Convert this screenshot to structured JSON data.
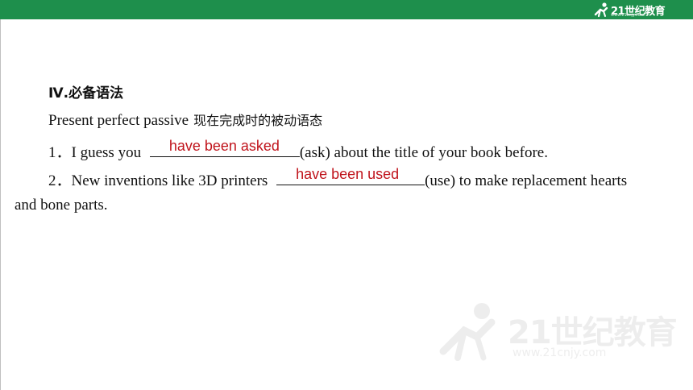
{
  "header": {
    "logo_text": "21世纪教育",
    "logo_url": "www.21cnjy.com",
    "bar_color": "#1e8f4c"
  },
  "content": {
    "heading": "Ⅳ.必备语法",
    "subheading_en": "Present perfect passive",
    "subheading_cn": "现在完成时的被动语态",
    "q1": {
      "number": "1．",
      "before": "I guess you",
      "answer": "have been asked",
      "after": "(ask) about the title of your book before."
    },
    "q2": {
      "number": "2．",
      "before": "New inventions like 3D printers",
      "answer": "have been used",
      "after": "(use) to make replacement hearts",
      "continuation": "and bone parts."
    },
    "answer_color": "#c0141c"
  },
  "watermark": {
    "text": "21世纪教育",
    "url": "www.21cnjy.com"
  }
}
